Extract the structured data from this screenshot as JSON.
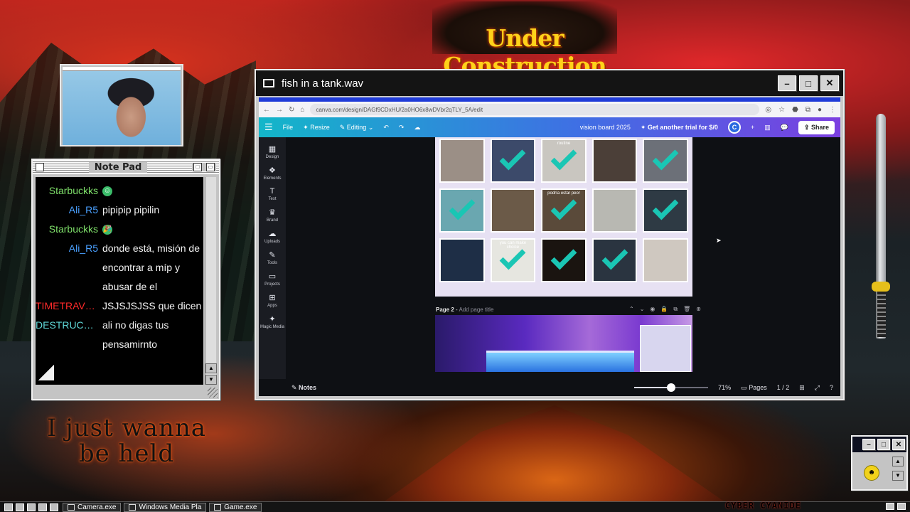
{
  "banner": {
    "text": "Under Construction"
  },
  "notepad": {
    "title": "Note Pad",
    "messages": [
      {
        "user": "Starbuckks",
        "user_color": "#7fe06a",
        "text": "",
        "emoji": "☺"
      },
      {
        "user": "Ali_R5",
        "user_color": "#4aa0ff",
        "text": "pipipip pipilin"
      },
      {
        "user": "Starbuckks",
        "user_color": "#7fe06a",
        "text": "",
        "emoji": "🎉"
      },
      {
        "user": "Ali_R5",
        "user_color": "#4aa0ff",
        "text": "donde está, misión de encontrar a míp y abusar de el"
      },
      {
        "user": "TIMETRAVEL...",
        "user_color": "#ff2a2a",
        "text": "JSJSJSJSS que dicen"
      },
      {
        "user": "DESTRUCTOR...",
        "user_color": "#5fd8d8",
        "text": "ali no digas tus pensamirnto"
      }
    ]
  },
  "overlay_text": {
    "line1": "I just wanna",
    "line2": "be held"
  },
  "window": {
    "title": "fish in a tank.wav",
    "browser": {
      "url": "canva.com/design/DAGf9CDxHU/2a0HO6x8wDVbr2qTLY_5A/edit"
    },
    "canva": {
      "menu": {
        "file": "File",
        "resize": "Resize",
        "editing": "Editing"
      },
      "doc_title": "vision board 2025",
      "trial": "Get another trial for $/0",
      "avatar": "C",
      "share": "Share",
      "rail": [
        {
          "label": "Design",
          "icon": "▦"
        },
        {
          "label": "Elements",
          "icon": "❖"
        },
        {
          "label": "Text",
          "icon": "T"
        },
        {
          "label": "Brand",
          "icon": "♛"
        },
        {
          "label": "Uploads",
          "icon": "☁"
        },
        {
          "label": "Tools",
          "icon": "✎"
        },
        {
          "label": "Projects",
          "icon": "▭"
        },
        {
          "label": "Apps",
          "icon": "⊞"
        },
        {
          "label": "Magic Media",
          "icon": "✦"
        }
      ],
      "tiles": [
        {
          "bg": "#9b8f86",
          "check": false,
          "caption": ""
        },
        {
          "bg": "#3c4a6a",
          "check": true,
          "caption": ""
        },
        {
          "bg": "#c9c6c0",
          "check": true,
          "caption": "routine"
        },
        {
          "bg": "#4b3f38",
          "check": false,
          "caption": ""
        },
        {
          "bg": "#6c7078",
          "check": true,
          "caption": ""
        },
        {
          "bg": "#6aa7b0",
          "check": true,
          "caption": ""
        },
        {
          "bg": "#6b5a48",
          "check": false,
          "caption": ""
        },
        {
          "bg": "#5a4a3a",
          "check": true,
          "caption": "podría estar peor"
        },
        {
          "bg": "#b8b8b2",
          "check": false,
          "caption": ""
        },
        {
          "bg": "#2e3a44",
          "check": true,
          "caption": ""
        },
        {
          "bg": "#1e2e46",
          "check": false,
          "caption": ""
        },
        {
          "bg": "#e6e6e0",
          "check": true,
          "caption": "you can make choice"
        },
        {
          "bg": "#1a1410",
          "check": true,
          "caption": ""
        },
        {
          "bg": "#2a3440",
          "check": true,
          "caption": ""
        },
        {
          "bg": "#cfc8c0",
          "check": false,
          "caption": ""
        }
      ],
      "page2": {
        "label": "Page 2",
        "placeholder": "Add page title"
      },
      "status": {
        "notes": "Notes",
        "zoom": "71%",
        "zoom_level": 0.5,
        "pages": "Pages",
        "page_count": "1 / 2"
      }
    }
  },
  "taskbar": {
    "tasks": [
      "Camera.exe",
      "Windows Media Pla",
      "Game.exe"
    ],
    "branding": "CYBER CYANIDE"
  }
}
